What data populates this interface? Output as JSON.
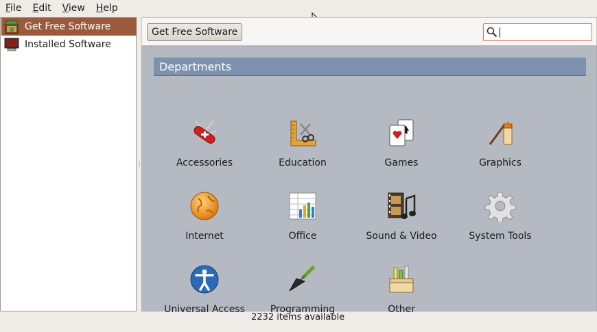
{
  "menubar": {
    "items": [
      {
        "label": "File"
      },
      {
        "label": "Edit"
      },
      {
        "label": "View"
      },
      {
        "label": "Help"
      }
    ]
  },
  "sidebar": {
    "items": [
      {
        "label": "Get Free Software",
        "selected": true,
        "icon": "software-store-icon"
      },
      {
        "label": "Installed Software",
        "selected": false,
        "icon": "monitor-icon"
      }
    ]
  },
  "toolbar": {
    "breadcrumb_label": "Get Free Software",
    "search_value": ""
  },
  "departments": {
    "title": "Departments",
    "items": [
      {
        "label": "Accessories",
        "icon": "swiss-knife-icon"
      },
      {
        "label": "Education",
        "icon": "scissors-ruler-icon"
      },
      {
        "label": "Games",
        "icon": "playing-cards-icon"
      },
      {
        "label": "Graphics",
        "icon": "paint-brush-icon"
      },
      {
        "label": "Internet",
        "icon": "globe-icon"
      },
      {
        "label": "Office",
        "icon": "spreadsheet-icon"
      },
      {
        "label": "Sound & Video",
        "icon": "film-music-icon"
      },
      {
        "label": "System Tools",
        "icon": "gear-icon"
      },
      {
        "label": "Universal Access",
        "icon": "accessibility-icon"
      },
      {
        "label": "Programming",
        "icon": "trowel-icon"
      },
      {
        "label": "Other",
        "icon": "toolbox-icon"
      }
    ]
  },
  "status": {
    "text": "2232 items available"
  },
  "colors": {
    "selection": "#9c5a3c",
    "department_header": "#7d92ad",
    "content_background": "#b5bac2",
    "search_border": "#d87a63"
  }
}
